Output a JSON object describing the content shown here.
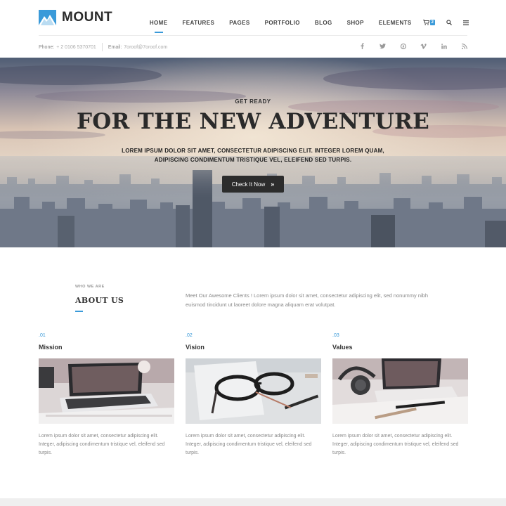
{
  "brand": {
    "name": "MOUNT",
    "accent": "#3a9ad9"
  },
  "nav": {
    "items": [
      {
        "label": "HOME",
        "active": true
      },
      {
        "label": "FEATURES",
        "active": false
      },
      {
        "label": "PAGES",
        "active": false
      },
      {
        "label": "PORTFOLIO",
        "active": false
      },
      {
        "label": "BLOG",
        "active": false
      },
      {
        "label": "SHOP",
        "active": false
      },
      {
        "label": "ELEMENTS",
        "active": false
      }
    ],
    "cart_count": "2",
    "icons": [
      "cart-icon",
      "search-icon",
      "menu-icon"
    ]
  },
  "topbar": {
    "phone_label": "Phone:",
    "phone_value": "+ 2 0106 5370701",
    "email_label": "Email:",
    "email_value": "7oroof@7oroof.com",
    "socials": [
      "facebook-icon",
      "twitter-icon",
      "pinterest-icon",
      "vimeo-icon",
      "linkedin-icon",
      "rss-icon"
    ]
  },
  "hero": {
    "kicker": "GET READY",
    "title": "FOR THE NEW ADVENTURE",
    "subtitle": "LOREM IPSUM DOLOR SIT AMET, CONSECTETUR ADIPISCING ELIT. INTEGER LOREM QUAM, ADIPISCING CONDIMENTUM TRISTIQUE VEL, ELEIFEND SED TURPIS.",
    "button_label": "Check It Now",
    "button_icon": "chevron-right-icon"
  },
  "about": {
    "kicker": "WHO WE ARE",
    "title": "ABOUT US",
    "text": "Meet Our Awesome Clients ! Lorem ipsum dolor sit amet, consectetur adipiscing elit, sed nonummy nibh euismod tincidunt ut laoreet dolore magna aliquam erat volutpat."
  },
  "columns": [
    {
      "num": ".01",
      "title": "Mission",
      "image": "laptop-desk-photo",
      "text": "Lorem ipsum dolor sit amet, consectetur adipiscing elit. Integer, adipiscing condimentum tristique vel, eleifend sed turpis."
    },
    {
      "num": ".02",
      "title": "Vision",
      "image": "eyeglasses-photo",
      "text": "Lorem ipsum dolor sit amet, consectetur adipiscing elit. Integer, adipiscing condimentum tristique vel, eleifend sed turpis."
    },
    {
      "num": ".03",
      "title": "Values",
      "image": "headphones-laptop-photo",
      "text": "Lorem ipsum dolor sit amet, consectetur adipiscing elit. Integer, adipiscing condimentum tristique vel, eleifend sed turpis."
    }
  ]
}
